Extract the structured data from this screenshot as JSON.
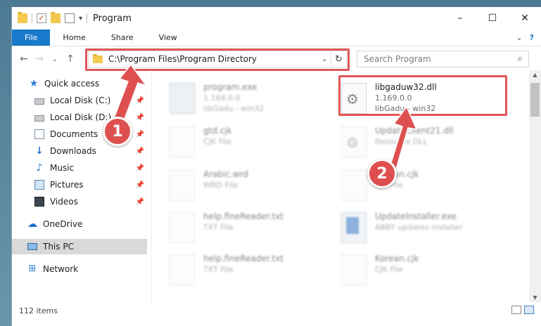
{
  "window": {
    "title": "Program",
    "controls": {
      "minimize": "–",
      "maximize": "☐",
      "close": "✕"
    }
  },
  "ribbon": {
    "tabs": [
      "File",
      "Home",
      "Share",
      "View"
    ],
    "collapse_glyph": "⌄",
    "help_glyph": "?"
  },
  "address": {
    "path": "C:\\Program Files\\Program Directory",
    "dropdown_glyph": "⌄",
    "refresh_glyph": "↻"
  },
  "nav": {
    "back": "←",
    "forward": "→",
    "recent": "⌄",
    "up": "↑"
  },
  "search": {
    "placeholder": "Search Program",
    "icon": "⌕"
  },
  "sidebar": {
    "items": [
      {
        "label": "Quick access",
        "icon": "star-icon",
        "pinned": false
      },
      {
        "label": "Local Disk (C:)",
        "icon": "disk-icon",
        "pinned": true
      },
      {
        "label": "Local Disk (D:)",
        "icon": "disk-icon",
        "pinned": true
      },
      {
        "label": "Documents",
        "icon": "documents-icon",
        "pinned": true
      },
      {
        "label": "Downloads",
        "icon": "download-icon",
        "pinned": true
      },
      {
        "label": "Music",
        "icon": "music-icon",
        "pinned": true
      },
      {
        "label": "Pictures",
        "icon": "pictures-icon",
        "pinned": true
      },
      {
        "label": "Videos",
        "icon": "videos-icon",
        "pinned": true
      },
      {
        "label": "OneDrive",
        "icon": "onedrive-icon",
        "pinned": false
      },
      {
        "label": "This PC",
        "icon": "this-pc-icon",
        "pinned": false,
        "selected": true
      },
      {
        "label": "Network",
        "icon": "network-icon",
        "pinned": false
      }
    ],
    "pin_glyph": "📌"
  },
  "files": [
    {
      "name": "program.exe",
      "line2": "1.169.0.0",
      "line3": "libGadu - win32",
      "icon": "exe-icon",
      "blurred": true
    },
    {
      "name": "libgaduw32.dll",
      "line2": "1.169.0.0",
      "line3": "libGadu - win32",
      "icon": "dll-gear-icon",
      "blurred": false
    },
    {
      "name": "gtd.cjk",
      "line2": "CJK File",
      "line3": "",
      "icon": "file-icon",
      "blurred": true
    },
    {
      "name": "UpdateClient21.dll",
      "line2": "Resource DLL",
      "line3": "",
      "icon": "dll-gear-icon",
      "blurred": true
    },
    {
      "name": "Arabic.wrd",
      "line2": "WRD File",
      "line3": "",
      "icon": "file-icon",
      "blurred": true
    },
    {
      "name": "Korean.cjk",
      "line2": "CJK File",
      "line3": "",
      "icon": "file-icon",
      "blurred": true
    },
    {
      "name": "help.fineReader.txt",
      "line2": "TXT File",
      "line3": "",
      "icon": "file-icon",
      "blurred": true
    },
    {
      "name": "UpdateInstaller.exe",
      "line2": "ABBY updates installer",
      "line3": "",
      "icon": "installer-icon",
      "blurred": true
    },
    {
      "name": "help.fineReader.txt",
      "line2": "TXT File",
      "line3": "",
      "icon": "file-icon",
      "blurred": true
    },
    {
      "name": "Korean.cjk",
      "line2": "CJK File",
      "line3": "",
      "icon": "file-icon",
      "blurred": true
    }
  ],
  "status": {
    "item_count": "112 items"
  },
  "callouts": {
    "first": "1",
    "second": "2",
    "color": "#de5050"
  }
}
